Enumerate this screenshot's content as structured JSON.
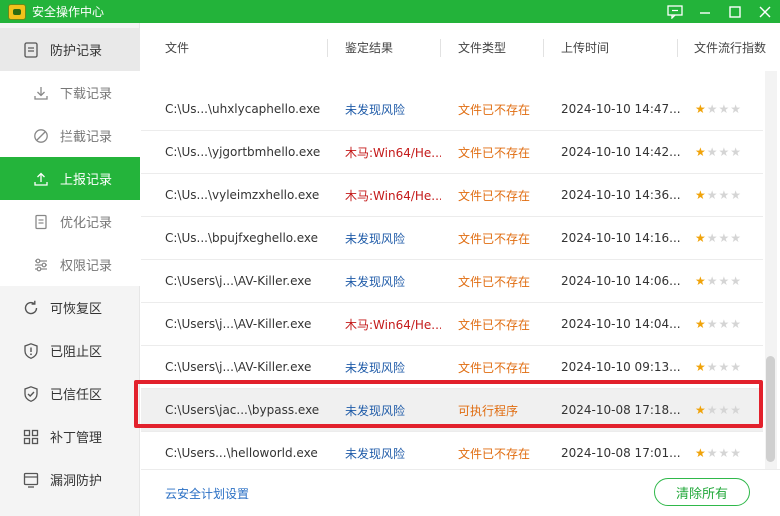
{
  "window": {
    "title": "安全操作中心"
  },
  "sidebar": {
    "items": [
      {
        "label": "防护记录",
        "icon": "shield-record-icon"
      },
      {
        "label": "下载记录",
        "icon": "download-icon"
      },
      {
        "label": "拦截记录",
        "icon": "block-icon"
      },
      {
        "label": "上报记录",
        "icon": "upload-icon"
      },
      {
        "label": "优化记录",
        "icon": "document-icon"
      },
      {
        "label": "权限记录",
        "icon": "permission-sliders-icon"
      },
      {
        "label": "可恢复区",
        "icon": "restore-icon"
      },
      {
        "label": "已阻止区",
        "icon": "shield-exclaim-icon"
      },
      {
        "label": "已信任区",
        "icon": "shield-check-icon"
      },
      {
        "label": "补丁管理",
        "icon": "patch-grid-icon"
      },
      {
        "label": "漏洞防护",
        "icon": "vulnerability-icon"
      }
    ]
  },
  "table": {
    "headers": [
      "文件",
      "鉴定结果",
      "文件类型",
      "上传时间",
      "文件流行指数"
    ],
    "rows": [
      {
        "file": "C:\\Us...\\uhxlycaphello.exe",
        "result": "未发现风险",
        "result_kind": "safe",
        "type": "文件已不存在",
        "time": "2024-10-10 14:47...",
        "rating": 1
      },
      {
        "file": "C:\\Us...\\yjgortbmhello.exe",
        "result": "木马:Win64/He...",
        "result_kind": "trojan",
        "type": "文件已不存在",
        "time": "2024-10-10 14:42...",
        "rating": 1
      },
      {
        "file": "C:\\Us...\\vyleimzxhello.exe",
        "result": "木马:Win64/He...",
        "result_kind": "trojan",
        "type": "文件已不存在",
        "time": "2024-10-10 14:36...",
        "rating": 1
      },
      {
        "file": "C:\\Us...\\bpujfxeghello.exe",
        "result": "未发现风险",
        "result_kind": "safe",
        "type": "文件已不存在",
        "time": "2024-10-10 14:16...",
        "rating": 1
      },
      {
        "file": "C:\\Users\\j...\\AV-Killer.exe",
        "result": "未发现风险",
        "result_kind": "safe",
        "type": "文件已不存在",
        "time": "2024-10-10 14:06...",
        "rating": 1
      },
      {
        "file": "C:\\Users\\j...\\AV-Killer.exe",
        "result": "木马:Win64/He...",
        "result_kind": "trojan",
        "type": "文件已不存在",
        "time": "2024-10-10 14:04...",
        "rating": 1
      },
      {
        "file": "C:\\Users\\j...\\AV-Killer.exe",
        "result": "未发现风险",
        "result_kind": "safe",
        "type": "文件已不存在",
        "time": "2024-10-10 09:13...",
        "rating": 1
      },
      {
        "file": "C:\\Users\\jac...\\bypass.exe",
        "result": "未发现风险",
        "result_kind": "safe",
        "type": "可执行程序",
        "time": "2024-10-08 17:18...",
        "rating": 1
      },
      {
        "file": "C:\\Users...\\helloworld.exe",
        "result": "未发现风险",
        "result_kind": "safe",
        "type": "文件已不存在",
        "time": "2024-10-08 17:01...",
        "rating": 1
      }
    ],
    "max_rating": 4,
    "highlighted_row": 7
  },
  "footer": {
    "link": "云安全计划设置",
    "clear_button": "清除所有"
  },
  "colors": {
    "brand_green": "#23b33a",
    "safe_blue": "#1f5ba8",
    "trojan_red": "#c41a1a",
    "type_orange": "#e06d11",
    "highlight_red": "#e2212c",
    "star_gold": "#f0a30a"
  }
}
